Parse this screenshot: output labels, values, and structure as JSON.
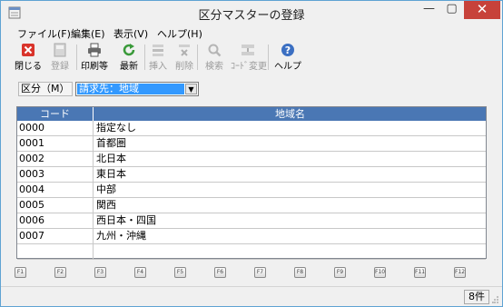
{
  "window": {
    "title": "区分マスターの登録",
    "close_glyph": "✕",
    "min_glyph": "—",
    "max_glyph": "▢"
  },
  "menu": [
    {
      "label": "ファイル(F)"
    },
    {
      "label": "編集(E)"
    },
    {
      "label": "表示(V)"
    },
    {
      "label": "ヘルプ(H)"
    }
  ],
  "toolbar": {
    "close_label": "閉じる",
    "register_label": "登録",
    "print_label": "印刷等",
    "refresh_label": "最新",
    "insert_label": "挿入",
    "delete_label": "削除",
    "search_label": "検索",
    "code_change_label": "ｺｰﾄﾞ変更",
    "help_label": "ヘルプ"
  },
  "filter": {
    "label": "区分（M）",
    "selected_value": "請求先：地域"
  },
  "table": {
    "headers": [
      "コード",
      "地域名"
    ],
    "rows": [
      {
        "code": "0000",
        "name": "指定なし"
      },
      {
        "code": "0001",
        "name": "首都圏"
      },
      {
        "code": "0002",
        "name": "北日本"
      },
      {
        "code": "0003",
        "name": "東日本"
      },
      {
        "code": "0004",
        "name": "中部"
      },
      {
        "code": "0005",
        "name": "関西"
      },
      {
        "code": "0006",
        "name": "西日本・四国"
      },
      {
        "code": "0007",
        "name": "九州・沖縄"
      },
      {
        "code": "",
        "name": ""
      }
    ]
  },
  "fkeys": [
    "F1",
    "F2",
    "F3",
    "F4",
    "F5",
    "F6",
    "F7",
    "F8",
    "F9",
    "F10",
    "F11",
    "F12"
  ],
  "status": {
    "count": "8件"
  },
  "colors": {
    "header_bg": "#4a77b4",
    "selection": "#3399ff",
    "close_button": "#c7423a",
    "window_border": "#5fa3d3"
  }
}
